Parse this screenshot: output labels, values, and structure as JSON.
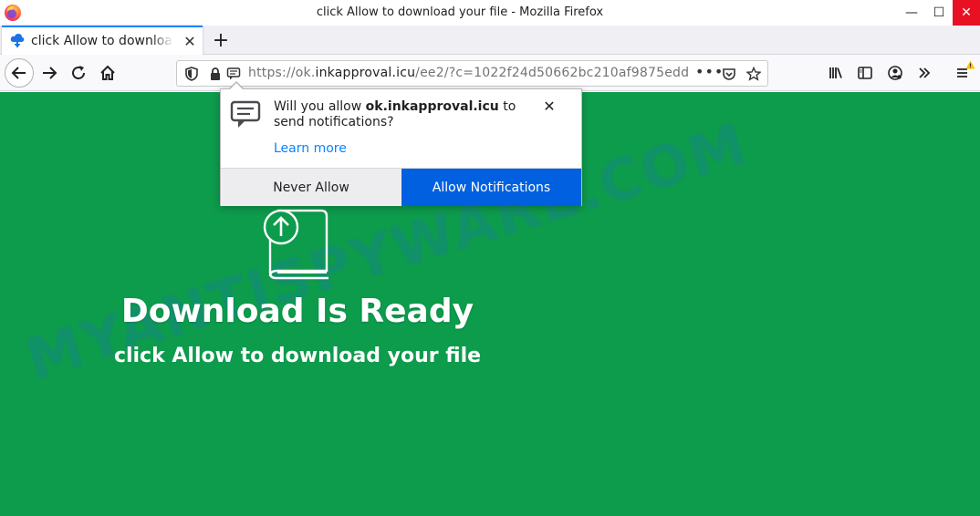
{
  "window": {
    "title": "click Allow to download your file - Mozilla Firefox",
    "minimize_glyph": "—",
    "maximize_glyph": "☐",
    "close_glyph": "✕"
  },
  "tabs": [
    {
      "label": "click Allow to download your file",
      "icon": "cloud-download-icon",
      "close_glyph": "✕",
      "active": true
    }
  ],
  "new_tab_glyph": "+",
  "urlbar": {
    "scheme": "https://ok.",
    "domain": "inkapproval.icu",
    "path": "/ee2/?c=1022f24d50662bc210af9875edd",
    "page_actions_glyph": "•••"
  },
  "notification_popup": {
    "message_prefix": "Will you allow ",
    "site": "ok.inkapproval.icu",
    "message_suffix": " to send notifications?",
    "learn_more": "Learn more",
    "deny_label": "Never Allow",
    "allow_label": "Allow Notifications",
    "close_glyph": "✕"
  },
  "page": {
    "headline": "Download Is Ready",
    "subline": "click Allow to download your file",
    "watermark": "MYANTISPYWARE.COM",
    "background_color": "#0d9b4c"
  },
  "colors": {
    "accent": "#0a84ff",
    "allow_button": "#0060df",
    "close_button": "#e81123"
  }
}
